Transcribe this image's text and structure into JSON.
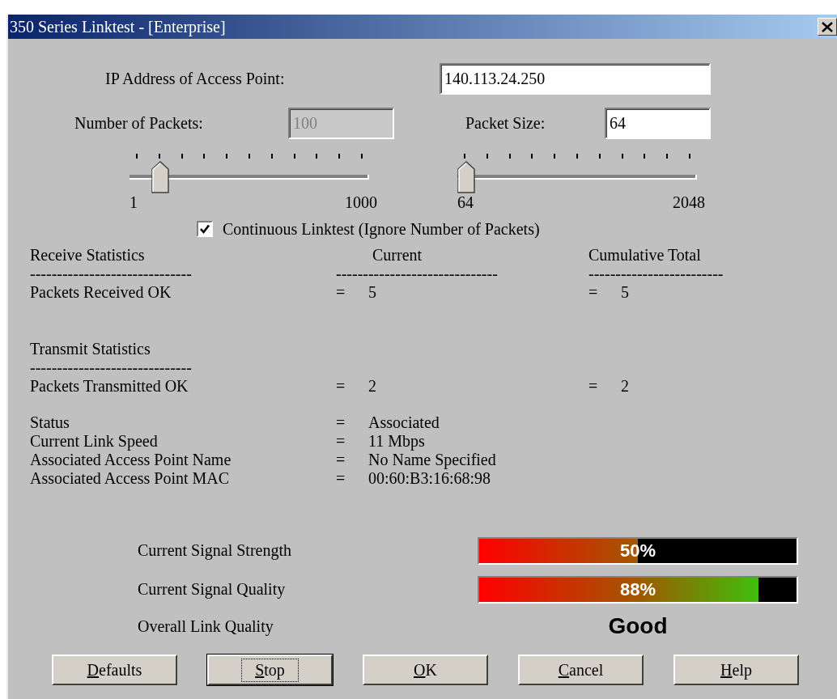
{
  "window": {
    "title": "350 Series Linktest - [Enterprise]"
  },
  "ip_address": {
    "label": "IP Address of Access Point:",
    "value": "140.113.24.250"
  },
  "packets": {
    "label": "Number of Packets:",
    "value": "100",
    "disabled": true
  },
  "packet_size": {
    "label": "Packet Size:",
    "value": "64",
    "disabled": false
  },
  "sliders": [
    {
      "min_label": "1",
      "max_label": "1000",
      "level": 0.1
    },
    {
      "min_label": "64",
      "max_label": "2048",
      "level": 0
    }
  ],
  "continuous": {
    "label": "Continuous Linktest (Ignore Number of Packets)",
    "checked": true
  },
  "stats": [
    {
      "rows": [
        {
          "kind": "header",
          "cells": [
            "Receive Statistics",
            "Current",
            "Cumulative Total"
          ]
        },
        {
          "kind": "rule",
          "cells": [
            "------------------------------",
            "------------------------------",
            "-------------------------"
          ]
        },
        {
          "kind": "value",
          "cells": [
            "Packets Received OK",
            "=",
            "5",
            "=",
            "5"
          ]
        }
      ]
    },
    {
      "rows": [
        {
          "kind": "header",
          "cells": [
            "Transmit Statistics"
          ]
        },
        {
          "kind": "rule",
          "cells": [
            "------------------------------"
          ]
        },
        {
          "kind": "value",
          "cells": [
            "Packets Transmitted OK",
            "=",
            "2",
            "=",
            "2"
          ]
        }
      ]
    },
    {
      "rows": [
        {
          "kind": "value",
          "cells": [
            "Status",
            "=",
            "Associated"
          ]
        },
        {
          "kind": "value",
          "cells": [
            "Current Link Speed",
            "=",
            "11 Mbps"
          ]
        },
        {
          "kind": "value",
          "cells": [
            "Associated Access Point Name",
            "=",
            "No Name Specified"
          ]
        },
        {
          "kind": "value",
          "cells": [
            "Associated Access Point MAC",
            "=",
            "00:60:B3:16:68:98"
          ]
        }
      ]
    }
  ],
  "meters": [
    {
      "label": "Current Signal Strength",
      "level": 0.5,
      "reading": "50%"
    },
    {
      "label": "Current Signal Quality",
      "level": 0.88,
      "reading": "88%"
    }
  ],
  "overall": {
    "label": "Overall Link Quality",
    "value": "Good"
  },
  "buttons": [
    {
      "label": "Defaults",
      "focused": false
    },
    {
      "label": "Stop",
      "focused": true
    },
    {
      "label": "OK",
      "focused": false
    },
    {
      "label": "Cancel",
      "focused": false
    },
    {
      "label": "Help",
      "focused": false
    }
  ]
}
